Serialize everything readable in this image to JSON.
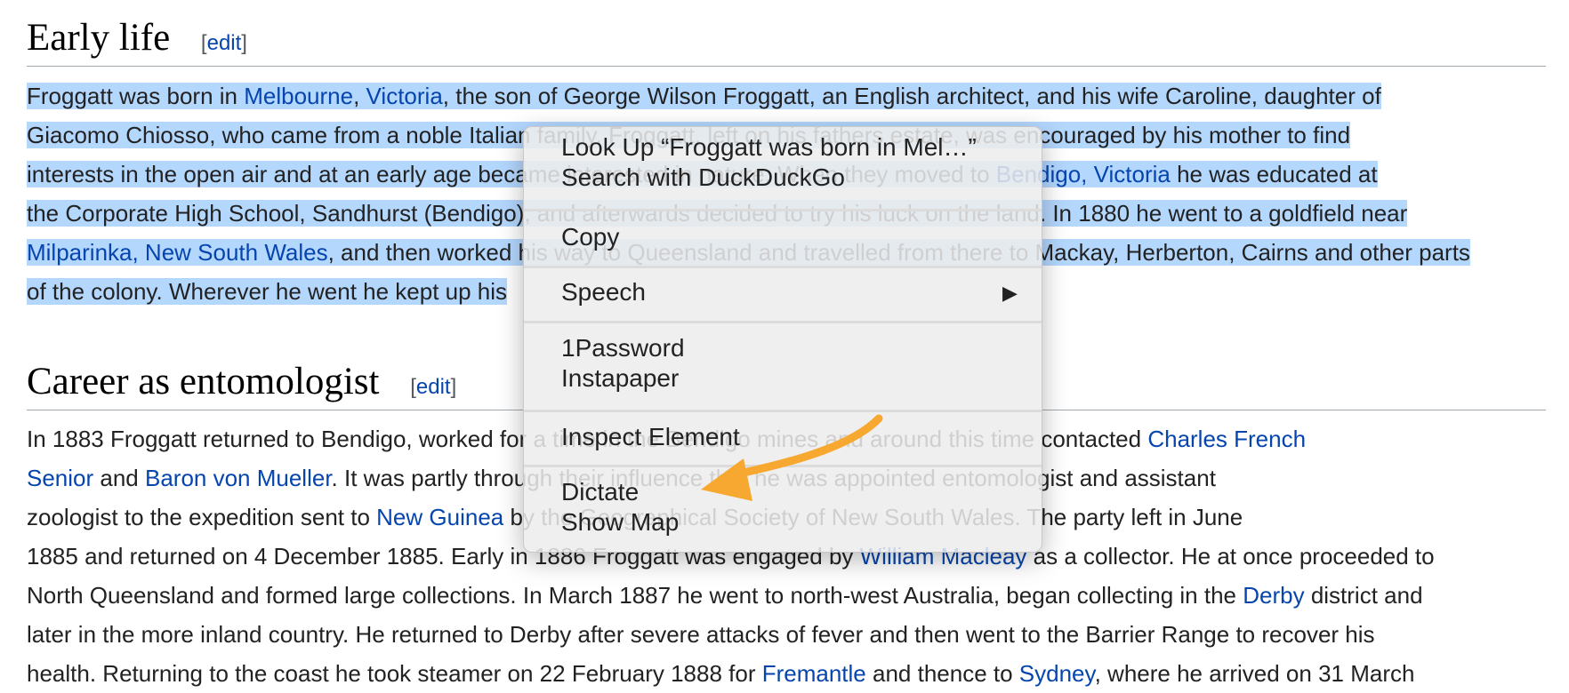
{
  "sections": [
    {
      "heading": "Early life",
      "edit_label": "edit",
      "lines": [
        {
          "segments": [
            {
              "text": "Froggatt was born in ",
              "link": false
            },
            {
              "text": "Melbourne",
              "link": true
            },
            {
              "text": ", ",
              "link": false
            },
            {
              "text": "Victoria",
              "link": true
            },
            {
              "text": ", the son of George Wilson Froggatt, an English architect, and his wife Caroline, daughter of",
              "link": false
            }
          ]
        },
        {
          "segments": [
            {
              "text": "Giacomo Chiosso, who came from a noble Italian family. Froggatt, left on his fathers estate, was encouraged by his mother to find",
              "link": false
            }
          ]
        },
        {
          "segments": [
            {
              "text": "interests in the open air and at an early age became interested in nature. When they moved to ",
              "link": false
            },
            {
              "text": "Bendigo, Victoria",
              "link": true
            },
            {
              "text": " he was educated at",
              "link": false
            }
          ]
        },
        {
          "segments": [
            {
              "text": "the Corporate High School, Sandhurst (Bendigo), and afterwards decided to try his luck on the land. In 1880 he went to a goldfield near",
              "link": false
            }
          ]
        },
        {
          "segments": [
            {
              "text": "Milparinka, New South Wales",
              "link": true
            },
            {
              "text": ", and then worked his way to Queensland and travelled from there to Mackay, Herberton, Cairns and other parts",
              "link": false
            }
          ]
        },
        {
          "segments": [
            {
              "text": "of the colony. Wherever he went he kept up his",
              "link": false
            }
          ]
        }
      ]
    },
    {
      "heading": "Career as entomologist",
      "edit_label": "edit",
      "lines": [
        {
          "segments": [
            {
              "text": "In 1883 Froggatt returned to Bendigo, worked for a time in the Bendigo mines and around this time contacted ",
              "link": false
            },
            {
              "text": "Charles French",
              "link": true
            }
          ]
        },
        {
          "segments": [
            {
              "text": "Senior",
              "link": true
            },
            {
              "text": " and ",
              "link": false
            },
            {
              "text": "Baron von Mueller",
              "link": true
            },
            {
              "text": ". It was partly through their influence that he was appointed entomologist and assistant",
              "link": false
            }
          ]
        },
        {
          "segments": [
            {
              "text": "zoologist to the expedition sent to ",
              "link": false
            },
            {
              "text": "New Guinea",
              "link": true
            },
            {
              "text": " by the Geographical Society of New South Wales. The party left in June",
              "link": false
            }
          ]
        },
        {
          "segments": [
            {
              "text": "1885 and returned on 4 December 1885. Early in 1886 Froggatt was engaged by ",
              "link": false
            },
            {
              "text": "William Macleay",
              "link": true
            },
            {
              "text": " as a collector. He at once proceeded to",
              "link": false
            }
          ]
        },
        {
          "segments": [
            {
              "text": "North Queensland and formed large collections. In March 1887 he went to north-west Australia, began collecting in the ",
              "link": false
            },
            {
              "text": "Derby",
              "link": true
            },
            {
              "text": " district and",
              "link": false
            }
          ]
        },
        {
          "segments": [
            {
              "text": "later in the more inland country. He returned to Derby after severe attacks of fever and then went to the Barrier Range to recover his",
              "link": false
            }
          ]
        },
        {
          "segments": [
            {
              "text": "health. Returning to the coast he took steamer on 22 February 1888 for ",
              "link": false
            },
            {
              "text": "Fremantle",
              "link": true
            },
            {
              "text": " and thence to ",
              "link": false
            },
            {
              "text": "Sydney",
              "link": true
            },
            {
              "text": ", where he arrived on 31 March",
              "link": false
            }
          ]
        }
      ]
    }
  ],
  "context_menu": {
    "lookup_label": "Look Up “Froggatt was born in Mel…”",
    "search_label": "Search with DuckDuckGo",
    "copy_label": "Copy",
    "speech_label": "Speech",
    "submenu_arrow": "▶",
    "onepassword_label": "1Password",
    "instapaper_label": "Instapaper",
    "inspect_label": "Inspect Element",
    "dictate_label": "Dictate",
    "showmap_label": "Show Map"
  },
  "colors": {
    "selection": "#b4d7fe",
    "link": "#0645ad",
    "annotation_arrow": "#f7a830",
    "menu_background": "#ececec"
  }
}
